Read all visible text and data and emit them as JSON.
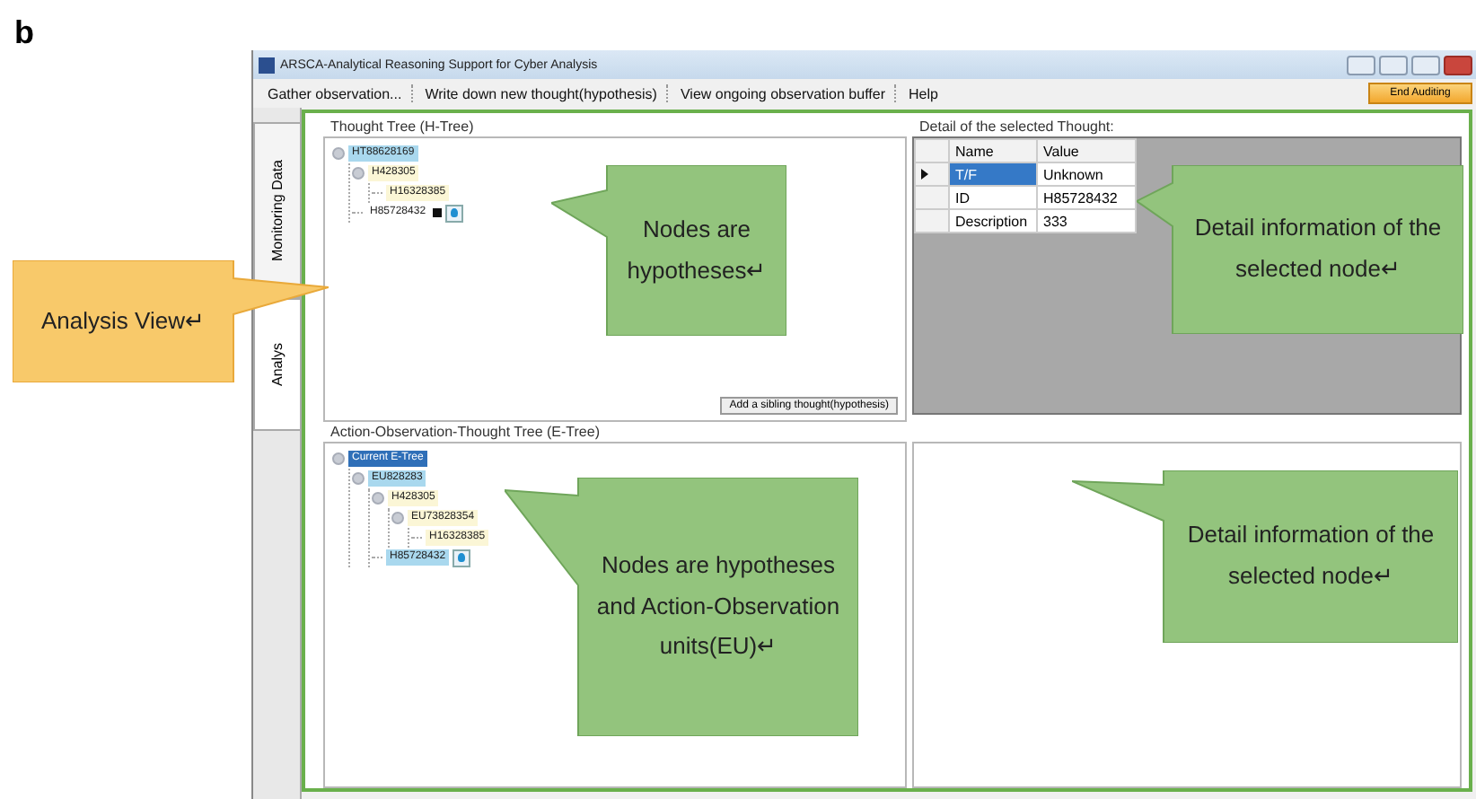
{
  "figure_label": "b",
  "window": {
    "title": "ARSCA-Analytical Reasoning Support for Cyber Analysis"
  },
  "menu": [
    {
      "label": "Gather observation..."
    },
    {
      "label": "Write down new thought(hypothesis)"
    },
    {
      "label": "View ongoing observation buffer"
    },
    {
      "label": "Help"
    }
  ],
  "end_button": "End Auditing",
  "side_tabs": [
    {
      "label": "Monitoring Data",
      "selected": false
    },
    {
      "label": "Analys",
      "selected": true
    }
  ],
  "h_tree": {
    "title": "Thought Tree (H-Tree)",
    "button": "Add a sibling thought(hypothesis)",
    "nodes": [
      {
        "label": "HT88628169",
        "color": "#a9d8ee",
        "children": [
          {
            "label": "H428305",
            "color": "#fbf6d6",
            "children": [
              {
                "label": "H16328385",
                "color": "#fbf6d6"
              }
            ]
          },
          {
            "label": "H85728432",
            "marker": true,
            "pin": true
          }
        ]
      }
    ]
  },
  "detail": {
    "title": "Detail of the selected Thought:",
    "columns": [
      "Name",
      "Value"
    ],
    "rows": [
      {
        "name": "T/F",
        "value": "Unknown",
        "selected": true
      },
      {
        "name": "ID",
        "value": "H85728432",
        "selected": false
      },
      {
        "name": "Description",
        "value": "333",
        "selected": false
      }
    ]
  },
  "e_tree": {
    "title": "Action-Observation-Thought Tree (E-Tree)",
    "nodes": [
      {
        "label": "Current E-Tree",
        "color": "#2f6fb8",
        "children": [
          {
            "label": "EU828283",
            "color": "#a9d8ee",
            "children": [
              {
                "label": "H428305",
                "color": "#fbf6d6",
                "children": [
                  {
                    "label": "EU73828354",
                    "color": "#fbf6d6",
                    "children": [
                      {
                        "label": "H16328385",
                        "color": "#fbf6d6"
                      }
                    ]
                  }
                ]
              },
              {
                "label": "H85728432",
                "color": "#a9d8ee",
                "pin": true
              }
            ]
          }
        ]
      }
    ]
  },
  "callouts": [
    {
      "kind": "view",
      "text": "Analysis View↵"
    },
    {
      "kind": "htree",
      "text": "Nodes are hypotheses↵"
    },
    {
      "kind": "detail",
      "text": "Detail information of the selected node↵"
    },
    {
      "kind": "etree",
      "text": "Nodes are hypotheses and Action-Observation units(EU)↵"
    },
    {
      "kind": "detail2",
      "text": "Detail information of the selected node↵"
    }
  ]
}
